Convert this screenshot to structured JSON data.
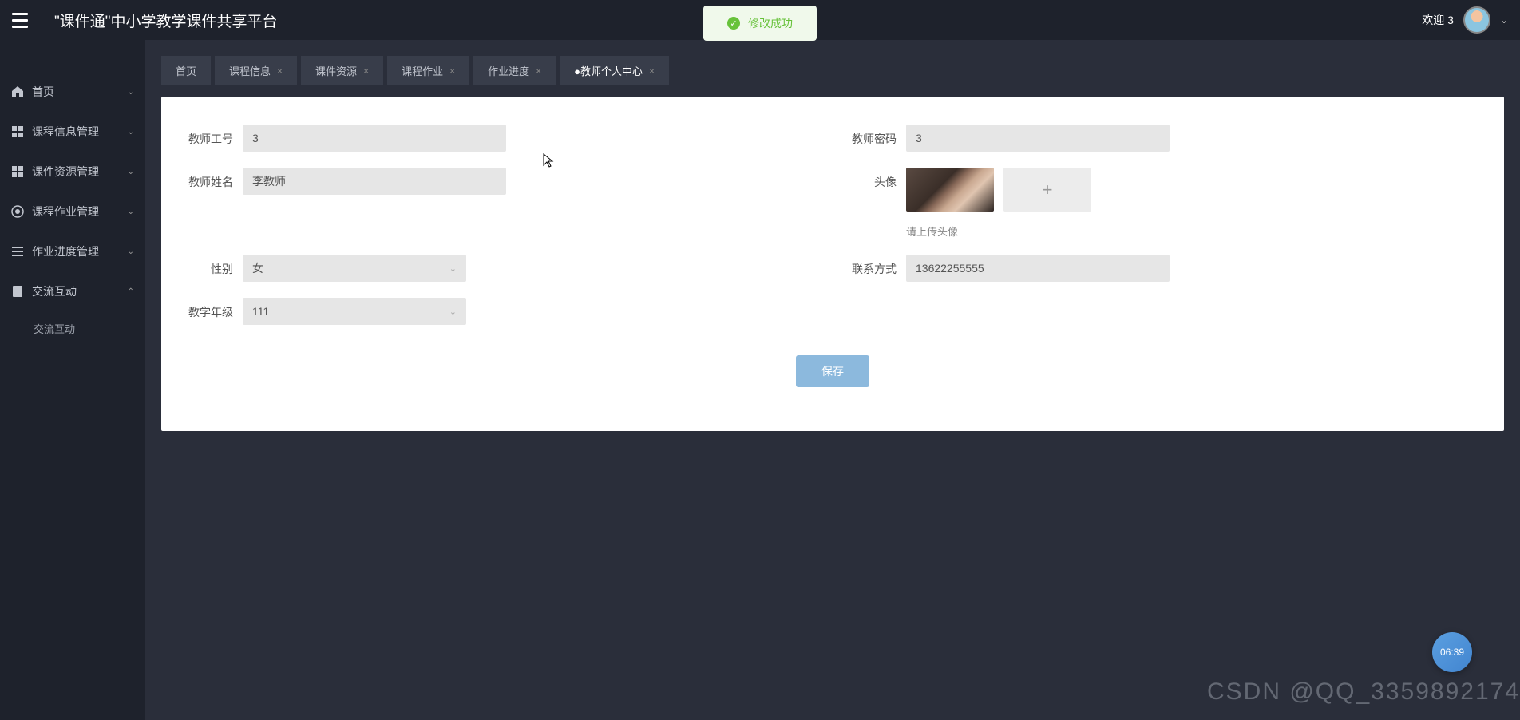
{
  "header": {
    "title": "\"课件通\"中小学教学课件共享平台",
    "welcome": "欢迎 3"
  },
  "notification": {
    "text": "修改成功"
  },
  "sidebar": {
    "items": [
      {
        "label": "首页",
        "icon": "home"
      },
      {
        "label": "课程信息管理",
        "icon": "grid"
      },
      {
        "label": "课件资源管理",
        "icon": "grid"
      },
      {
        "label": "课程作业管理",
        "icon": "disc"
      },
      {
        "label": "作业进度管理",
        "icon": "bars"
      },
      {
        "label": "交流互动",
        "icon": "book"
      }
    ],
    "subitems": [
      {
        "label": "交流互动"
      }
    ]
  },
  "tabs": [
    {
      "label": "首页",
      "closable": false
    },
    {
      "label": "课程信息",
      "closable": true
    },
    {
      "label": "课件资源",
      "closable": true
    },
    {
      "label": "课程作业",
      "closable": true
    },
    {
      "label": "作业进度",
      "closable": true
    },
    {
      "label": "●教师个人中心",
      "closable": true,
      "active": true
    }
  ],
  "form": {
    "teacher_id": {
      "label": "教师工号",
      "value": "3"
    },
    "teacher_pwd": {
      "label": "教师密码",
      "value": "3"
    },
    "teacher_name": {
      "label": "教师姓名",
      "value": "李教师"
    },
    "avatar": {
      "label": "头像",
      "hint": "请上传头像"
    },
    "gender": {
      "label": "性别",
      "value": "女"
    },
    "contact": {
      "label": "联系方式",
      "value": "13622255555"
    },
    "grade": {
      "label": "教学年级",
      "value": "111"
    },
    "save_label": "保存"
  },
  "floating": {
    "time": "06:39"
  },
  "watermark": "CSDN @QQ_3359892174"
}
